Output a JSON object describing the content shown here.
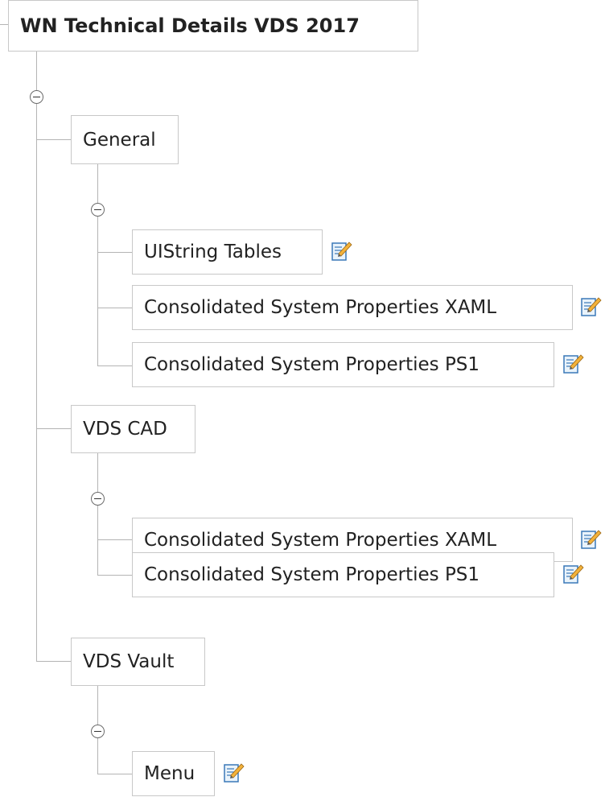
{
  "root": {
    "label": "WN Technical Details VDS 2017"
  },
  "nodes": {
    "general": {
      "label": "General",
      "children": [
        {
          "label": "UIString Tables"
        },
        {
          "label": "Consolidated System Properties XAML"
        },
        {
          "label": "Consolidated System Properties PS1"
        }
      ]
    },
    "vds_cad": {
      "label": "VDS CAD",
      "children": [
        {
          "label": "Consolidated System Properties XAML"
        },
        {
          "label": "Consolidated System Properties PS1"
        }
      ]
    },
    "vds_vault": {
      "label": "VDS Vault",
      "children": [
        {
          "label": "Menu"
        }
      ]
    }
  },
  "icons": {
    "collapse": "minus-circle-icon",
    "edit": "edit-pencil-icon"
  },
  "colors": {
    "connector": "#b4b4b4",
    "box_border": "#c8c8c8",
    "text": "#222222"
  }
}
